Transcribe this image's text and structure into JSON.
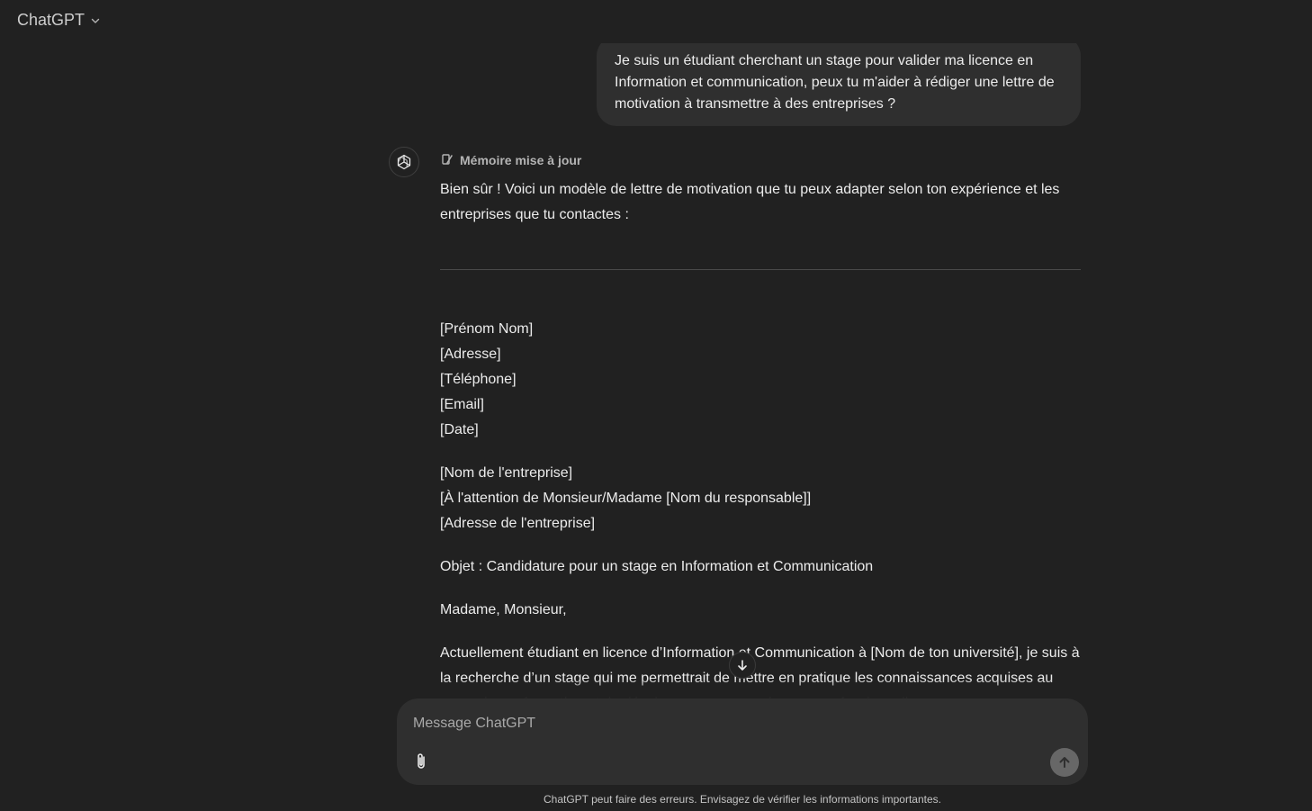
{
  "header": {
    "model_name": "ChatGPT",
    "model_icon": "chevron-down-icon"
  },
  "conversation": {
    "user_message": "Je suis un étudiant cherchant un stage pour valider ma licence en Information et communication, peux tu m'aider à rédiger une lettre de motivation à transmettre à des entreprises ?",
    "assistant": {
      "memory_status": "Mémoire mise à jour",
      "intro": "Bien sûr ! Voici un modèle de lettre de motivation que tu peux adapter selon ton expérience et les entreprises que tu contactes :",
      "sender_block": [
        "[Prénom Nom]",
        "[Adresse]",
        "[Téléphone]",
        "[Email]",
        "[Date]"
      ],
      "recipient_block": [
        "[Nom de l'entreprise]",
        "[À l'attention de Monsieur/Madame [Nom du responsable]]",
        "[Adresse de l'entreprise]"
      ],
      "subject": "Objet : Candidature pour un stage en Information et Communication",
      "salutation": "Madame, Monsieur,",
      "body_paragraph": "Actuellement étudiant en licence d’Information et Communication à [Nom de ton université], je suis à la recherche d’un stage qui me permettrait de mettre en pratique les connaissances acquises au cours de ma formation et de développer mes compétences professionnelles"
    }
  },
  "composer": {
    "placeholder": "Message ChatGPT",
    "attach_icon": "paperclip-icon",
    "send_icon": "arrow-up-icon"
  },
  "footer": {
    "disclaimer": "ChatGPT peut faire des erreurs. Envisagez de vérifier les informations importantes."
  },
  "colors": {
    "background": "#212121",
    "bubble": "#2f2f2f",
    "text": "#ececec",
    "muted": "#b4b4b4",
    "send_button": "#676767"
  }
}
